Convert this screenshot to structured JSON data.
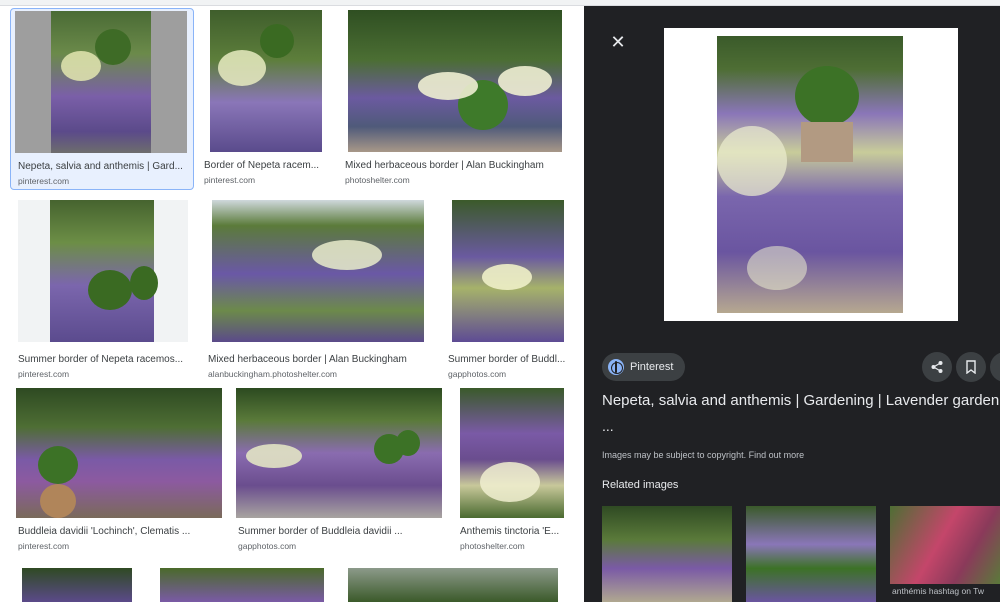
{
  "results": [
    {
      "caption": "Nepeta, salvia and anthemis | Gard...",
      "source": "pinterest.com",
      "selected": true
    },
    {
      "caption": "Border of Nepeta racem...",
      "source": "pinterest.com"
    },
    {
      "caption": "Mixed herbaceous border | Alan Buckingham",
      "source": "photoshelter.com"
    },
    {
      "caption": "Summer border of Nepeta racemos...",
      "source": "pinterest.com"
    },
    {
      "caption": "Mixed herbaceous border | Alan Buckingham",
      "source": "alanbuckingham.photoshelter.com"
    },
    {
      "caption": "Summer border of Buddl...",
      "source": "gapphotos.com"
    },
    {
      "caption": "Buddleia davidii 'Lochinch', Clematis ...",
      "source": "pinterest.com"
    },
    {
      "caption": "Summer border of Buddleia davidii ...",
      "source": "gapphotos.com"
    },
    {
      "caption": "Anthemis tinctoria 'E...",
      "source": "photoshelter.com"
    }
  ],
  "panel": {
    "close_symbol": "✕",
    "source_name": "Pinterest",
    "title": "Nepeta, salvia and anthemis | Gardening | Lavender garden",
    "ellipsis": "...",
    "copyright_text": "Images may be subject to copyright.",
    "learn_more": "Find out more",
    "related_heading": "Related images",
    "related_caption": "anthémis hashtag on Tw"
  },
  "icons": {
    "close": "close-icon",
    "source": "globe-icon",
    "share": "share-icon",
    "save": "bookmark-icon",
    "more": "more-icon"
  },
  "colors": {
    "panel_bg": "#202124",
    "accent": "#8ab4f8",
    "chip_bg": "#3c4043"
  }
}
